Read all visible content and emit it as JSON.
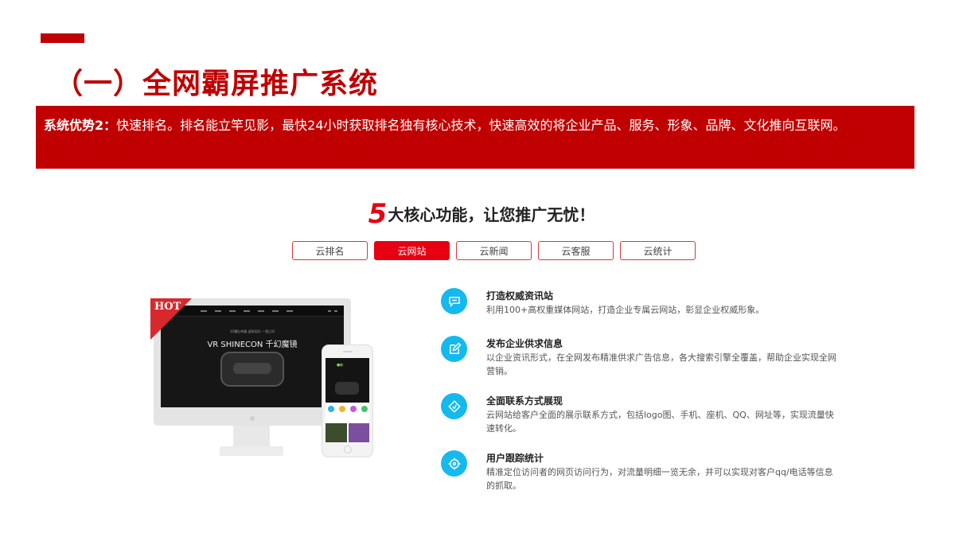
{
  "title": "（一）全网霸屏推广系统",
  "banner": {
    "label": "系统优势2：",
    "text": "快速排名。排名能立竿见影，最快24小时获取排名独有核心技术，快速高效的将企业产品、服务、形象、品牌、文化推向互联网。"
  },
  "headline": {
    "number": "5",
    "text": "大核心功能，让您推广无忧！"
  },
  "tabs": [
    {
      "label": "云排名",
      "active": false
    },
    {
      "label": "云网站",
      "active": true
    },
    {
      "label": "云新闻",
      "active": false
    },
    {
      "label": "云客服",
      "active": false
    },
    {
      "label": "云统计",
      "active": false
    }
  ],
  "illustration": {
    "hot_label": "HOT",
    "vr_title": "VR SHINECON 千幻魔镜",
    "vr_subtitle": "3D魔幻神器 虚拟现实 一镜之间"
  },
  "features": [
    {
      "icon": "chat-icon",
      "title": "打造权威资讯站",
      "desc": "利用100+高权重媒体网站，打造企业专属云网站，彰显企业权威形象。"
    },
    {
      "icon": "edit-icon",
      "title": "发布企业供求信息",
      "desc": "以企业资讯形式，在全网发布精准供求广告信息，各大搜索引擎全覆盖，帮助企业实现全网营销。"
    },
    {
      "icon": "tag-icon",
      "title": "全面联系方式展现",
      "desc": "云网站给客户全面的展示联系方式，包括logo图、手机、座机、QQ、网址等，实现流量快速转化。"
    },
    {
      "icon": "target-icon",
      "title": "用户跟踪统计",
      "desc": "精准定位访问者的网页访问行为，对流量明细一览无余，并可以实现对客户qq/电话等信息的抓取。"
    }
  ],
  "colors": {
    "brand_red": "#c00000",
    "tab_red": "#e60012",
    "icon_blue": "#14b9ee"
  }
}
